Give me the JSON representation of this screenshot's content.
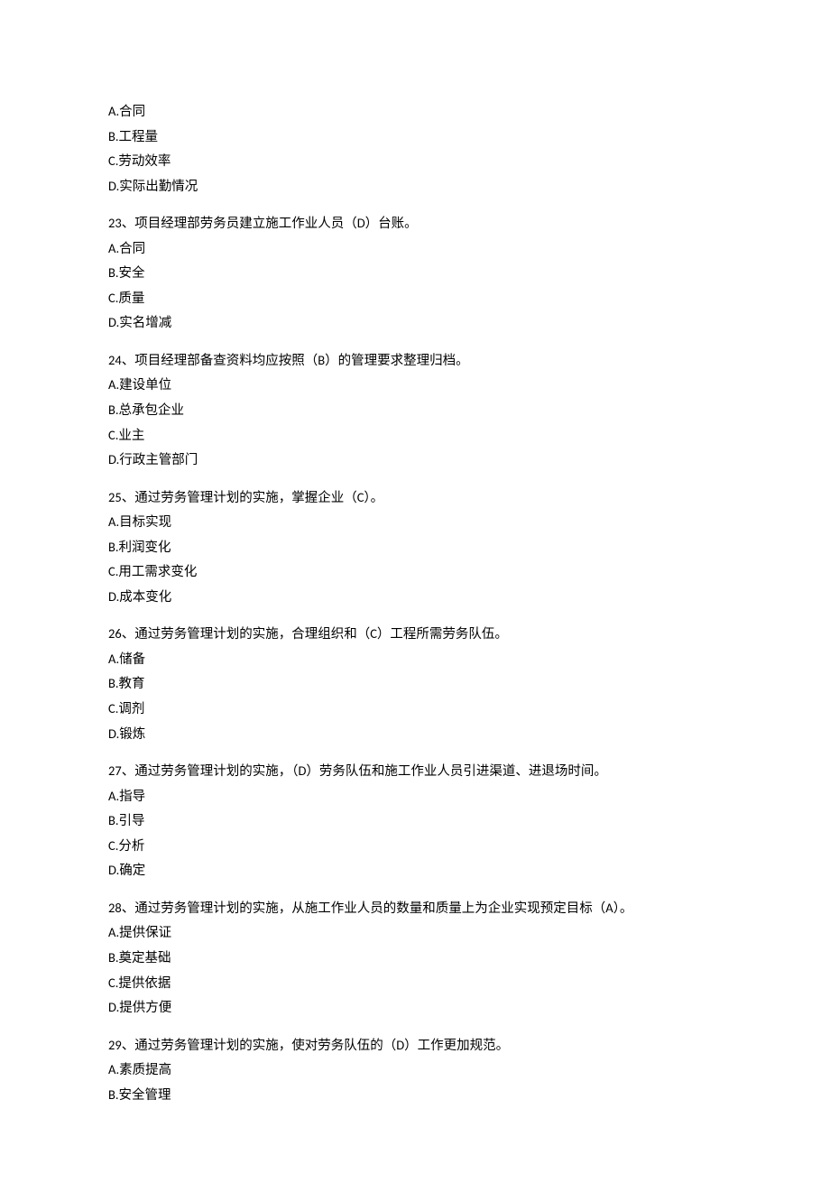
{
  "prelude": {
    "options": [
      "A.合同",
      "B.工程量",
      "C.劳动效率",
      "D.实际出勤情况"
    ]
  },
  "questions": [
    {
      "stem": "23、项目经理部劳务员建立施工作业人员（D）台账。",
      "options": [
        "A.合同",
        "B.安全",
        "C.质量",
        "D.实名增减"
      ]
    },
    {
      "stem": "24、项目经理部备查资料均应按照（B）的管理要求整理归档。",
      "options": [
        "A.建设单位",
        "B.总承包企业",
        "C.业主",
        "D.行政主管部门"
      ]
    },
    {
      "stem": "25、通过劳务管理计划的实施，掌握企业（C）。",
      "options": [
        "A.目标实现",
        "B.利润变化",
        "C.用工需求变化",
        "D.成本变化"
      ]
    },
    {
      "stem": "26、通过劳务管理计划的实施，合理组织和（C）工程所需劳务队伍。",
      "options": [
        "A.储备",
        "B.教育",
        "C.调剂",
        "D.锻炼"
      ]
    },
    {
      "stem": "27、通过劳务管理计划的实施，（D）劳务队伍和施工作业人员引进渠道、进退场时间。",
      "options": [
        "A.指导",
        "B.引导",
        "C.分析",
        "D.确定"
      ]
    },
    {
      "stem": "28、通过劳务管理计划的实施，从施工作业人员的数量和质量上为企业实现预定目标（A）。",
      "options": [
        "A.提供保证",
        "B.奠定基础",
        "C.提供依据",
        "D.提供方便"
      ]
    },
    {
      "stem": "29、通过劳务管理计划的实施，使对劳务队伍的（D）工作更加规范。",
      "options": [
        "A.素质提高",
        "B.安全管理"
      ]
    }
  ]
}
